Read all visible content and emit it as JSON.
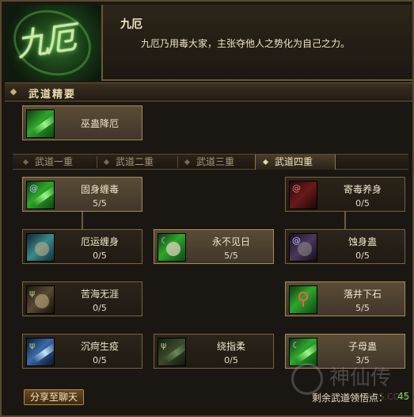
{
  "header": {
    "portrait_text": "九厄",
    "title": "九厄",
    "description": "九厄乃用毒大家，主张夺他人之势化为自己之力。"
  },
  "section": {
    "title": "武道精要"
  },
  "core_skill": {
    "name": "巫蛊降厄",
    "icon": "poison-swirl-icon"
  },
  "tabs": [
    {
      "label": "武道一重",
      "selected": false
    },
    {
      "label": "武道二重",
      "selected": false
    },
    {
      "label": "武道三重",
      "selected": false
    },
    {
      "label": "武道四重",
      "selected": true
    }
  ],
  "skills": [
    {
      "name": "固身缠毒",
      "count": "5/5",
      "active": true,
      "icon": "green-blade-icon"
    },
    {
      "name": "寄毒养身",
      "count": "0/5",
      "active": false,
      "icon": "red-swirl-icon"
    },
    {
      "name": "厄运缠身",
      "count": "0/5",
      "active": false,
      "icon": "teal-gauntlet-icon"
    },
    {
      "name": "永不见日",
      "count": "5/5",
      "active": true,
      "icon": "moon-cloud-icon"
    },
    {
      "name": "蚀身蛊",
      "count": "0/5",
      "active": false,
      "icon": "purple-gauntlet-icon"
    },
    {
      "name": "苦海无涯",
      "count": "0/5",
      "active": false,
      "icon": "brown-fist-icon"
    },
    {
      "name": "落井下石",
      "count": "5/5",
      "active": true,
      "icon": "red-figure-icon"
    },
    {
      "name": "沉疴生疫",
      "count": "0/5",
      "active": false,
      "icon": "blue-slash-icon"
    },
    {
      "name": "绕指柔",
      "count": "0/5",
      "active": false,
      "icon": "green-ribbon-icon"
    },
    {
      "name": "子母蛊",
      "count": "3/5",
      "active": true,
      "icon": "moon-blade-icon"
    }
  ],
  "footer": {
    "share_label": "分享至聊天",
    "remaining_label": "剩余武道领悟点：",
    "remaining_value": "45"
  },
  "watermark": {
    "text": "神仙传",
    "url": "www.SXDS.COM"
  }
}
